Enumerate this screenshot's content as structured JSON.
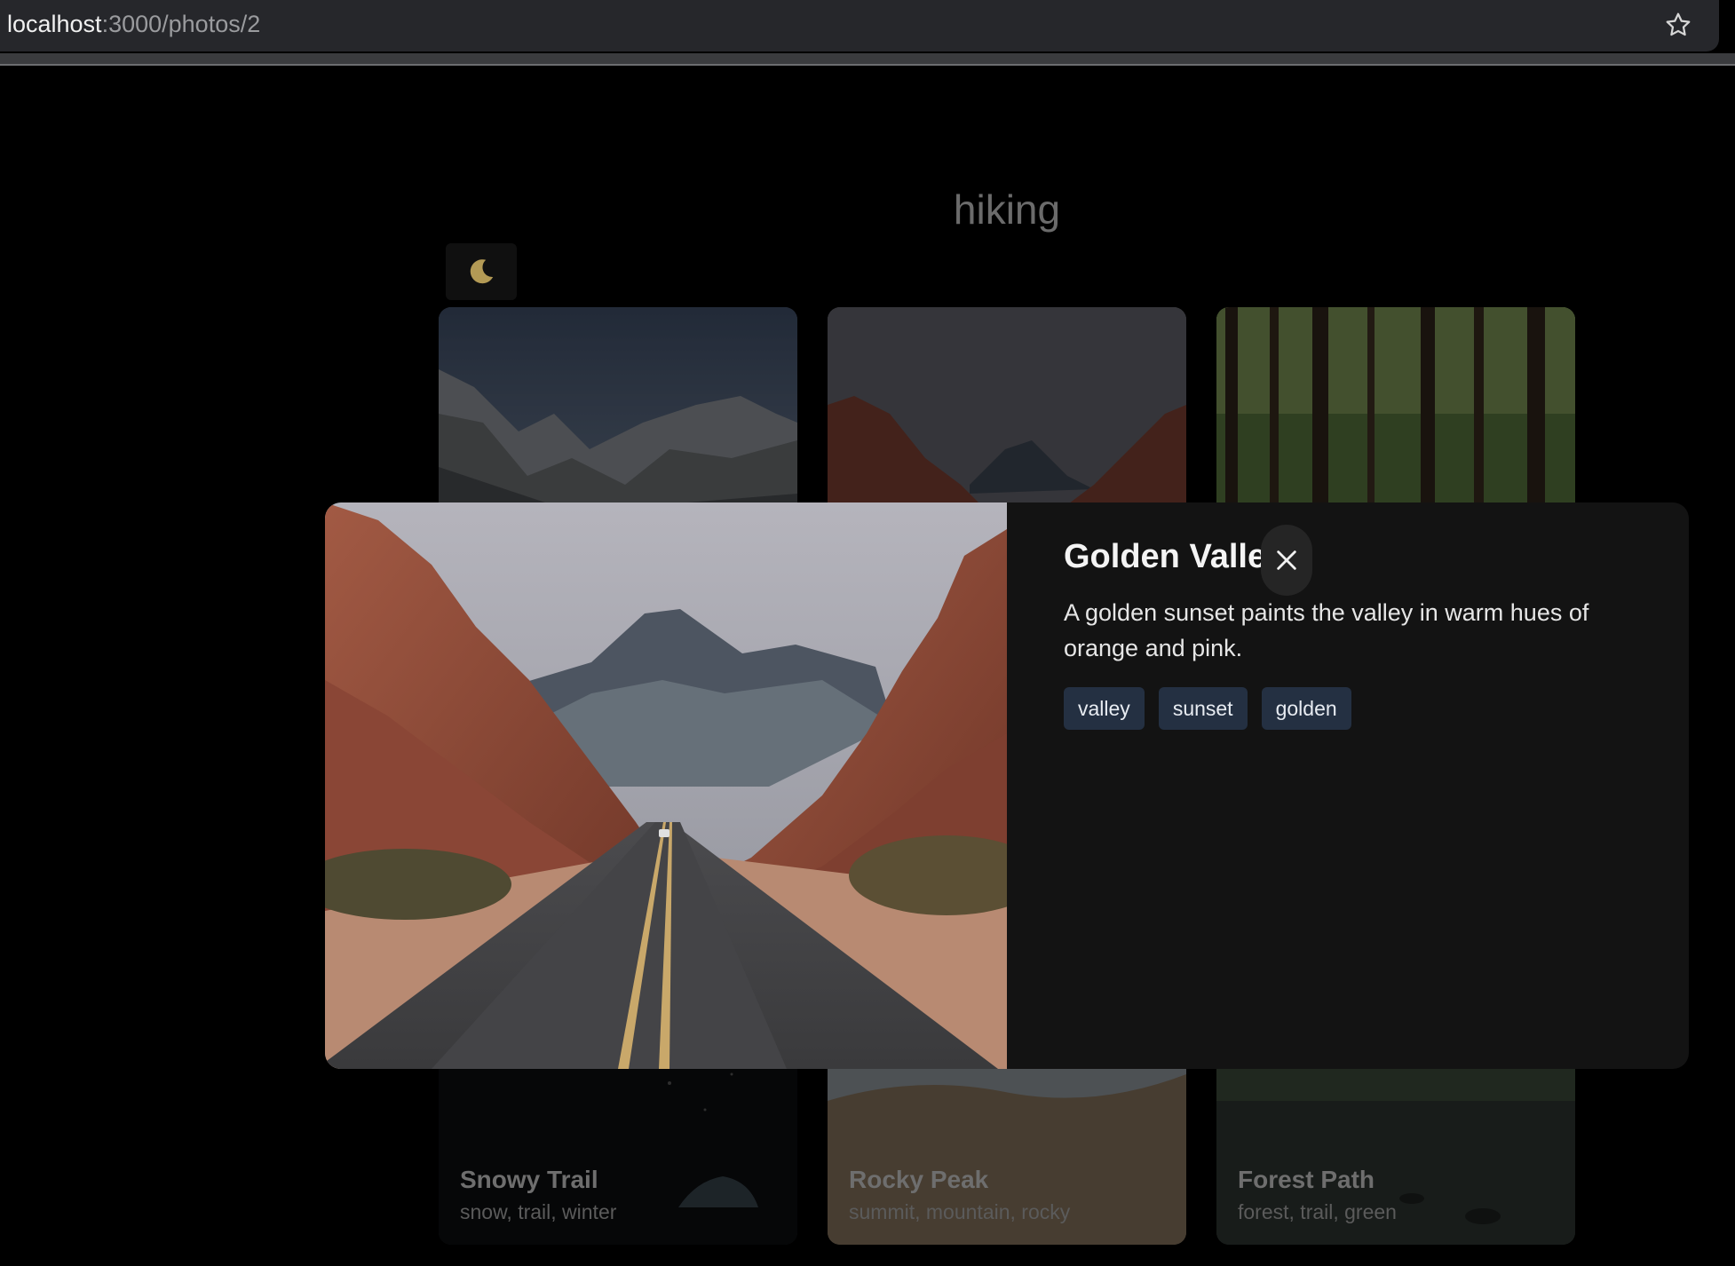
{
  "browser": {
    "url_host": "localhost",
    "url_path": ":3000/photos/2",
    "bookmark_icon": "star-icon"
  },
  "page": {
    "title": "hiking",
    "theme_toggle_icon": "moon-icon"
  },
  "gallery": {
    "cards": [
      {
        "title": "",
        "tags": "",
        "scene": "mountain-ridge"
      },
      {
        "title": "",
        "tags": "",
        "scene": "red-rock-valley"
      },
      {
        "title": "",
        "tags": "",
        "scene": "pine-forest"
      },
      {
        "title": "Snowy Trail",
        "tags": "snow, trail, winter",
        "scene": "night-camp"
      },
      {
        "title": "Rocky Peak",
        "tags": "summit, mountain, rocky",
        "scene": "beach"
      },
      {
        "title": "Forest Path",
        "tags": "forest, trail, green",
        "scene": "river-rocks"
      }
    ]
  },
  "modal": {
    "title": "Golden Valley",
    "description": "A golden sunset paints the valley in warm hues of orange and pink.",
    "tags": [
      "valley",
      "sunset",
      "golden"
    ],
    "close_icon": "close-icon"
  },
  "colors": {
    "page_bg": "#000000",
    "modal_bg": "#131313",
    "tag_bg": "#243042",
    "urlbar_bg": "#26272b"
  }
}
